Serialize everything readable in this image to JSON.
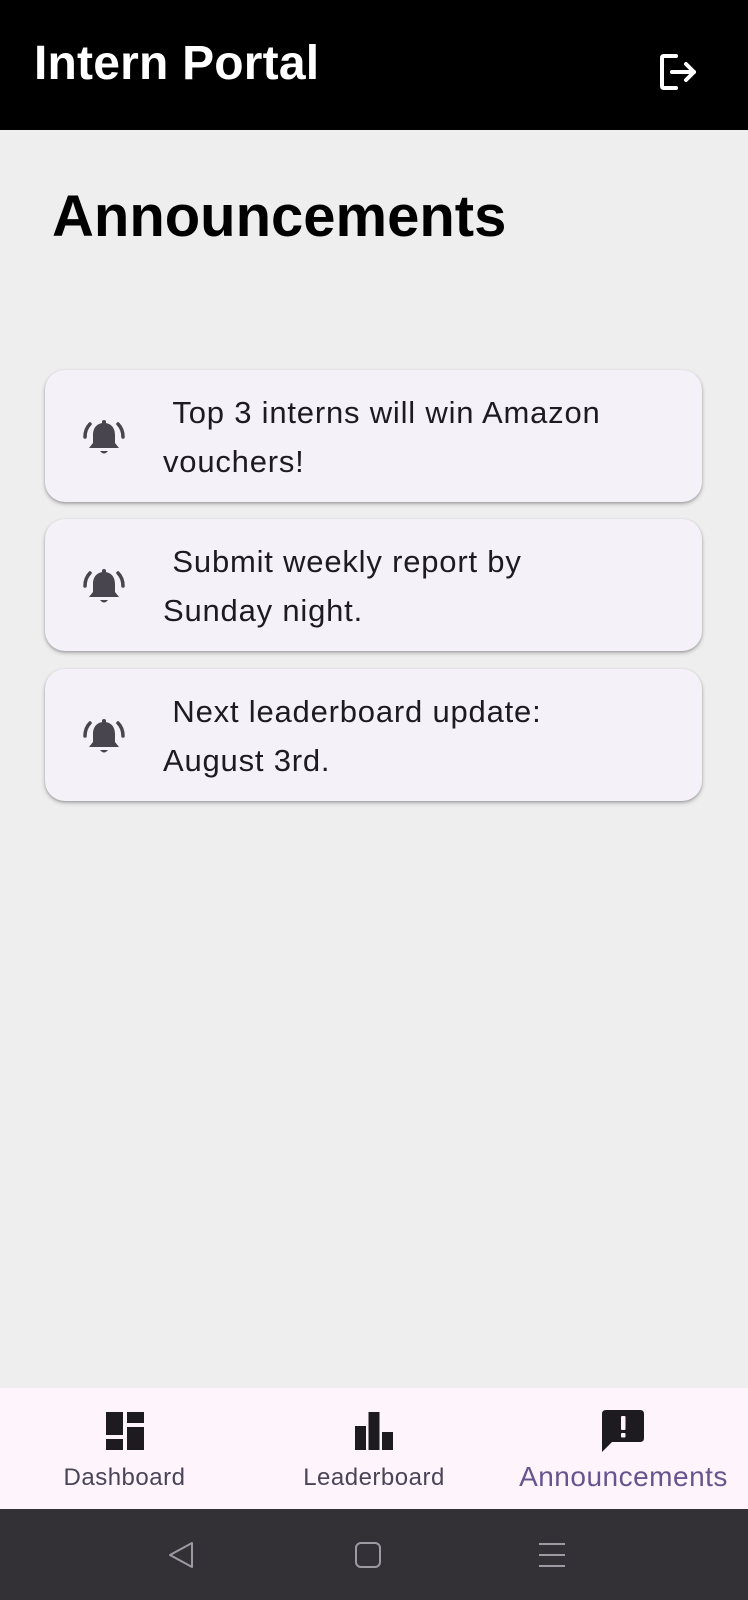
{
  "app_bar": {
    "title": "Intern Portal",
    "logout_icon": "logout-icon"
  },
  "page": {
    "title": "Announcements"
  },
  "announcements": [
    {
      "icon": "bell-ringing-icon",
      "text": " Top 3 interns will win Amazon\nvouchers!"
    },
    {
      "icon": "bell-ringing-icon",
      "text": " Submit weekly report by\nSunday night."
    },
    {
      "icon": "bell-ringing-icon",
      "text": " Next leaderboard update:\nAugust 3rd."
    }
  ],
  "bottom_nav": {
    "items": [
      {
        "label": "Dashboard",
        "icon": "dashboard-icon",
        "active": false
      },
      {
        "label": "Leaderboard",
        "icon": "bar-chart-icon",
        "active": false
      },
      {
        "label": "Announcements",
        "icon": "announcement-icon",
        "active": true
      }
    ]
  },
  "system_nav": {
    "back_icon": "back-triangle-icon",
    "home_icon": "home-square-icon",
    "menu_icon": "menu-lines-icon"
  },
  "colors": {
    "app_bar_bg": "#000000",
    "page_bg": "#eeeeee",
    "card_bg": "#f4f1f8",
    "nav_bg": "#fdf5fb",
    "nav_active": "#65558f",
    "nav_inactive": "#4a4458",
    "icon_color": "#49454f"
  }
}
